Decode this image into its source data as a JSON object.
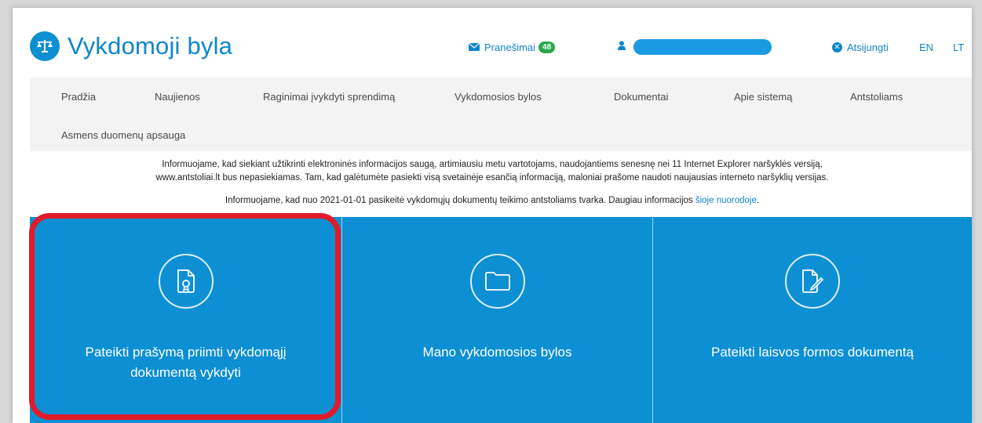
{
  "header": {
    "title": "Vykdomoji byla",
    "messages_label": "Pranešimai",
    "messages_count": "48",
    "logout_label": "Atsijungti",
    "lang_en": "EN",
    "lang_lt": "LT"
  },
  "nav": {
    "items": [
      "Pradžia",
      "Naujienos",
      "Raginimai įvykdyti sprendimą",
      "Vykdomosios bylos",
      "Dokumentai",
      "Apie sistemą",
      "Antstoliams",
      "Asmens duomenų apsauga"
    ]
  },
  "notices": {
    "line1": "Informuojame, kad siekiant užtikrinti elektroninės informacijos saugą, artimiausiu metu vartotojams, naudojantiems senesnę nei 11 Internet Explorer naršyklės versiją,",
    "line2": "www.antstoliai.lt bus nepasiekiamas. Tam, kad galėtumėte pasiekti visą svetainėje esančią informaciją, maloniai prašome naudoti naujausias interneto naršyklių versijas.",
    "line3_text": "Informuojame, kad nuo 2021-01-01 pasikeitė vykdomųjų dokumentų teikimo antstoliams tvarka. Daugiau informacijos ",
    "line3_link": "šioje nuorodoje",
    "line3_end": "."
  },
  "tiles": [
    {
      "line1": "Pateikti prašymą priimti vykdomąjį",
      "line2": "dokumentą vykdyti",
      "icon": "certificate-document-icon"
    },
    {
      "line1": "Mano vykdomosios bylos",
      "line2": "",
      "icon": "folder-icon"
    },
    {
      "line1": "Pateikti laisvos formos dokumentą",
      "line2": "",
      "icon": "edit-document-icon"
    }
  ],
  "colors": {
    "brand_blue": "#0d8fd3",
    "badge_green": "#2aa84a",
    "highlight_red": "#e01b2a"
  }
}
